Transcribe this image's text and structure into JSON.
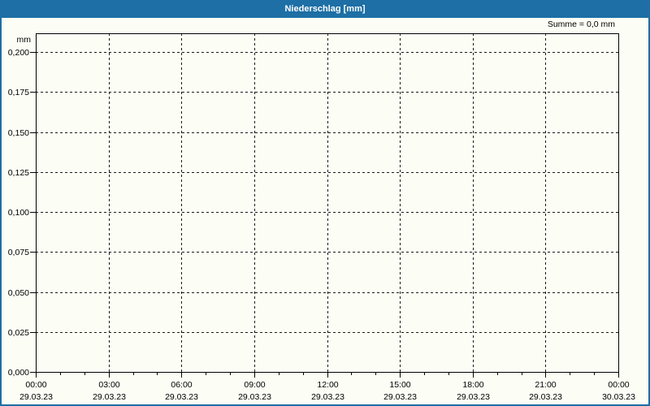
{
  "window": {
    "title": "Niederschlag [mm]"
  },
  "colors": {
    "titlebar_bg": "#1d6fa5",
    "titlebar_text": "#ffffff",
    "frame_border": "#1d6fa5",
    "page_bg": "#fcfdf5",
    "axis": "#000000",
    "grid": "#1a1a1a",
    "label": "#000000"
  },
  "chart_data": {
    "type": "line",
    "title": "Niederschlag [mm]",
    "ylabel": "mm",
    "annotation": "Summe = 0,0 mm",
    "sum_value_mm": 0.0,
    "grid": "dashed",
    "legend": "none",
    "y_axis": {
      "min": 0.0,
      "max": 0.2,
      "tick_step": 0.025,
      "ticks": [
        {
          "value": 0.0,
          "label": "0,000"
        },
        {
          "value": 0.025,
          "label": "0,025"
        },
        {
          "value": 0.05,
          "label": "0,050"
        },
        {
          "value": 0.075,
          "label": "0,075"
        },
        {
          "value": 0.1,
          "label": "0,100"
        },
        {
          "value": 0.125,
          "label": "0,125"
        },
        {
          "value": 0.15,
          "label": "0,150"
        },
        {
          "value": 0.175,
          "label": "0,175"
        },
        {
          "value": 0.2,
          "label": "0,200"
        }
      ]
    },
    "x_axis": {
      "hours_total": 24,
      "minor_tick_every_hours": 1,
      "major_tick_every_hours": 3,
      "major_ticks": [
        {
          "time": "00:00",
          "date": "29.03.23"
        },
        {
          "time": "03:00",
          "date": "29.03.23"
        },
        {
          "time": "06:00",
          "date": "29.03.23"
        },
        {
          "time": "09:00",
          "date": "29.03.23"
        },
        {
          "time": "12:00",
          "date": "29.03.23"
        },
        {
          "time": "15:00",
          "date": "29.03.23"
        },
        {
          "time": "18:00",
          "date": "29.03.23"
        },
        {
          "time": "21:00",
          "date": "29.03.23"
        },
        {
          "time": "00:00",
          "date": "30.03.23"
        }
      ]
    },
    "series": []
  }
}
